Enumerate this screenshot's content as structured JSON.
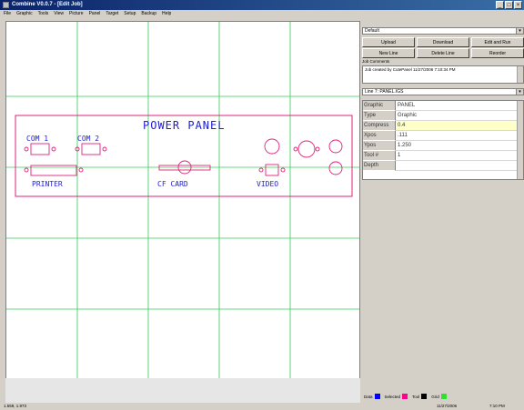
{
  "window": {
    "title": "Combine V0.0.7 - [Edit Job]",
    "buttons": [
      "_",
      "□",
      "×"
    ]
  },
  "menu": [
    "File",
    "Graphic",
    "Tools",
    "View",
    "Picture",
    "Panel",
    "Target",
    "Setup",
    "Backup",
    "Help"
  ],
  "canvas": {
    "panel_title": "POWER PANEL",
    "labels": {
      "com1": "COM 1",
      "com2": "COM 2",
      "printer": "PRINTER",
      "cf_card": "CF CARD",
      "video": "VIDEO"
    },
    "colors": {
      "grid": "#33cc55",
      "panel": "#e0207a",
      "text": "#2020d0"
    }
  },
  "side": {
    "top_select": "Default",
    "buttons": {
      "upload": "Upload",
      "download": "Download",
      "edit_run": "Edit and Run",
      "new_line": "New Line",
      "delete_line": "Delete Line",
      "reorder": "Reorder"
    },
    "comments_label": "Job Comments",
    "comments_text": "Job created by CutePanel 11/27/2006 7:10:34 PM",
    "line_select": "Line 7: PANEL.IGS",
    "props": [
      {
        "k": "Graphic",
        "v": "PANEL",
        "hl": false
      },
      {
        "k": "Type",
        "v": "Graphic",
        "hl": false
      },
      {
        "k": "Compress",
        "v": "0.4",
        "hl": true
      },
      {
        "k": "Xpos",
        "v": ".111",
        "hl": false
      },
      {
        "k": "Ypos",
        "v": "1.250",
        "hl": false
      },
      {
        "k": "Tool #",
        "v": "1",
        "hl": false
      },
      {
        "k": "Depth",
        "v": "",
        "hl": false
      }
    ]
  },
  "legend": {
    "data": "Data",
    "selected": "Selected",
    "tool": "Tool",
    "grid": "Grid",
    "colors": {
      "data": "#0000ff",
      "selected": "#ff0090",
      "tool": "#000000",
      "grid": "#33dd33"
    }
  },
  "status": {
    "left": "1.559, 1.973",
    "mid": "11/27/2006",
    "right": "7:10 PM"
  }
}
